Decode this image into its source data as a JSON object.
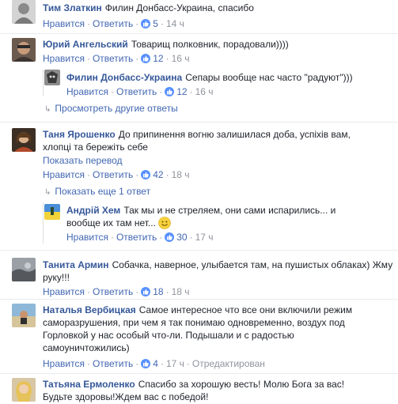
{
  "ui": {
    "like": "Нравится",
    "reply": "Ответить",
    "see_other_replies": "Просмотреть другие ответы",
    "see_translation": "Показать перевод",
    "show_more_1": "Показать еще 1 ответ",
    "edited": "Отредактирован"
  },
  "comments": [
    {
      "name": "Тим Златкин",
      "text": "Филин Донбасс-Украина, спасибо",
      "likes": "5",
      "time": "14 ч"
    },
    {
      "name": "Юрий Ангельский",
      "text": "Товарищ полковник, порадовали))))",
      "likes": "12",
      "time": "16 ч"
    },
    {
      "name": "Филин Донбасс-Украина",
      "text": "Сепары вообще нас часто \"радуют\")))",
      "likes": "12",
      "time": "16 ч"
    },
    {
      "name": "Таня Ярошенко",
      "text": "До припинення вогню залишилася доба, успіхів вам, хлопці та бережіть себе",
      "likes": "42",
      "time": "18 ч"
    },
    {
      "name": "Андрій Хем",
      "text": "Так мы и не стреляем, они сами испарились... и вообще их там нет...",
      "likes": "30",
      "time": "17 ч"
    },
    {
      "name": "Танита Армин",
      "text": "Собачка, наверное, улыбается там, на пушистых облаках) Жму руку!!!",
      "likes": "18",
      "time": "18 ч"
    },
    {
      "name": "Наталья Вербицкая",
      "text": "Самое интересное что все они включили режим саморазрушения, при чем я так понимаю одновременно, воздух под Горловкой у нас особый что-ли. Подышали и с радостью самоуничтожились)",
      "likes": "4",
      "time": "17 ч"
    },
    {
      "name": "Татьяна Ермоленко",
      "text": "Спасибо за хорошую весть! Молю Бога за вас! Будьте здоровы!Ждем вас с победой!"
    }
  ],
  "colors": {
    "link": "#365899",
    "action": "#4267b2",
    "meta": "#90949c",
    "like_badge": "#5890ff"
  }
}
